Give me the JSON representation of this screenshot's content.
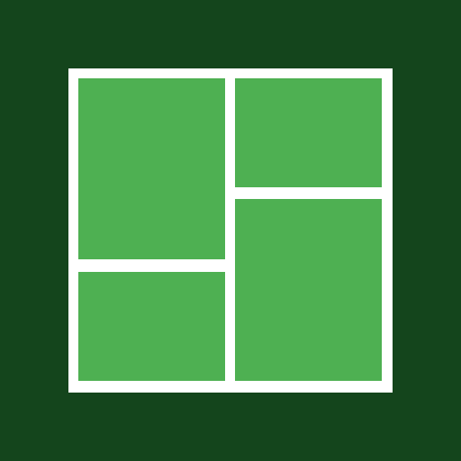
{
  "icon": {
    "name": "layout-grid-icon",
    "colors": {
      "background": "#14451c",
      "frame": "#ffffff",
      "tile": "#4eb052"
    },
    "tiles": [
      "top-left",
      "top-right",
      "bottom-left",
      "bottom-right"
    ]
  }
}
